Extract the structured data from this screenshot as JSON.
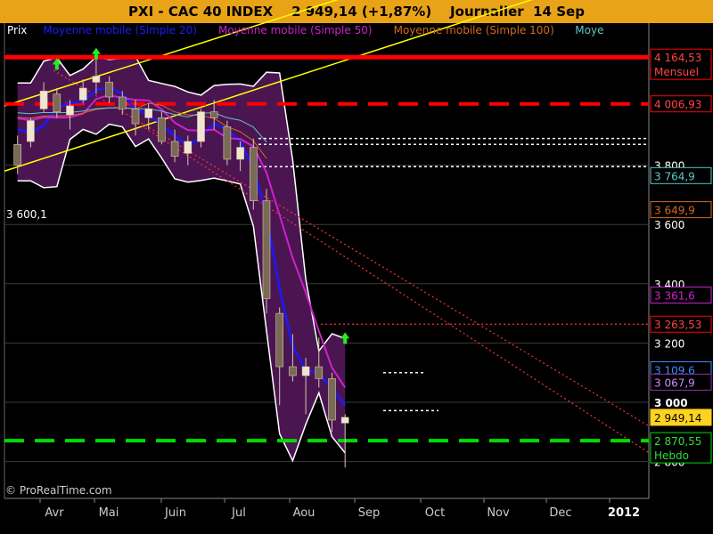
{
  "title": "PXI - CAC 40 INDEX    2 949,14 (+1,87%)    Journalier  14 Sep",
  "colors": {
    "title_bg": "#e8a317",
    "background": "#000000",
    "bands_fill": "#4b1552",
    "ma20": "#1a1aff",
    "ma50": "#cc22cc",
    "ma100": "#d2691e",
    "ma200": "#5fc7c7",
    "red_line": "#ff0000",
    "green_line": "#00dd00",
    "yellow_channel": "#ffff00",
    "candle": "#d8c8b0"
  },
  "chart_data": {
    "type": "candlestick",
    "instrument": "CAC 40 INDEX",
    "period": "Journalier",
    "last_date": "14 Sep",
    "last_value": "2 949,14",
    "change": "+1,87%",
    "y_ticks": [
      "3 800",
      "3 600",
      "3 400",
      "3 200",
      "3 000",
      "2 800"
    ],
    "x_months": [
      "Avr",
      "Mai",
      "Juin",
      "Jul",
      "Aou",
      "Sep",
      "Oct",
      "Nov",
      "Dec",
      "2012"
    ],
    "legend": [
      {
        "name": "Prix",
        "color": "#ffffff"
      },
      {
        "name": "Moyenne mobile (Simple 20)",
        "color": "#1a1aff"
      },
      {
        "name": "Moyenne mobile (Simple 50)",
        "color": "#cc22cc"
      },
      {
        "name": "Moyenne mobile (Simple 100)",
        "color": "#d2691e"
      },
      {
        "name": "Moye",
        "color": "#5fc7c7"
      }
    ],
    "value_tags": [
      {
        "value": 4164.53,
        "label": "4 164,53",
        "sub": "Mensuel",
        "bg": "#000000",
        "fg": "#ff4444",
        "border": "#ff0000"
      },
      {
        "value": 4006.93,
        "label": "4 006,93",
        "bg": "#000000",
        "fg": "#ff4444",
        "border": "#ff0000"
      },
      {
        "value": 3764.9,
        "label": "3 764,9",
        "bg": "#000000",
        "fg": "#5fc7c7",
        "border": "#5fc7c7"
      },
      {
        "value": 3649.9,
        "label": "3 649,9",
        "bg": "#000000",
        "fg": "#d2691e",
        "border": "#d2691e"
      },
      {
        "value": 3361.6,
        "label": "3 361,6",
        "bg": "#000000",
        "fg": "#cc22cc",
        "border": "#cc22cc"
      },
      {
        "value": 3263.53,
        "label": "3 263,53",
        "bg": "#000000",
        "fg": "#ff4444",
        "border": "#ff0000"
      },
      {
        "value": 3109.6,
        "label": "3 109,6",
        "bg": "#000000",
        "fg": "#3a8cff",
        "border": "#3a8cff"
      },
      {
        "value": 3067.9,
        "label": "3 067,9",
        "bg": "#000000",
        "fg": "#cc88ff",
        "border": "#8833aa"
      },
      {
        "value": 2949.14,
        "label": "2 949,14",
        "bg": "#ffd21f",
        "fg": "#000000",
        "border": "#ffd21f"
      },
      {
        "value": 2870.55,
        "label": "2 870,55",
        "sub": "Hebdo",
        "bg": "#000000",
        "fg": "#33dd33",
        "border": "#00dd00"
      }
    ],
    "horizontal_levels": [
      {
        "value": 4164.53,
        "style": "solid",
        "color": "#ff0000"
      },
      {
        "value": 4006.93,
        "style": "dashed",
        "color": "#ff0000"
      },
      {
        "value": 3263.53,
        "style": "dotted",
        "color": "#ff3333"
      },
      {
        "value": 2870.55,
        "style": "dashed",
        "color": "#00dd00"
      }
    ],
    "left_label": "3 600,1",
    "candles": [
      {
        "d": "03-21",
        "o": 3870,
        "h": 3900,
        "l": 3770,
        "c": 3800
      },
      {
        "d": "03-28",
        "o": 3880,
        "h": 3960,
        "l": 3860,
        "c": 3950
      },
      {
        "d": "04-04",
        "o": 3990,
        "h": 4080,
        "l": 3980,
        "c": 4050
      },
      {
        "d": "04-11",
        "o": 4040,
        "h": 4060,
        "l": 3960,
        "c": 3980
      },
      {
        "d": "04-18",
        "o": 3970,
        "h": 4020,
        "l": 3920,
        "c": 4000
      },
      {
        "d": "04-25",
        "o": 4020,
        "h": 4090,
        "l": 4010,
        "c": 4060
      },
      {
        "d": "05-02",
        "o": 4080,
        "h": 4170,
        "l": 4040,
        "c": 4100
      },
      {
        "d": "05-09",
        "o": 4080,
        "h": 4100,
        "l": 4010,
        "c": 4030
      },
      {
        "d": "05-16",
        "o": 4030,
        "h": 4050,
        "l": 3970,
        "c": 3990
      },
      {
        "d": "05-23",
        "o": 3990,
        "h": 4020,
        "l": 3900,
        "c": 3940
      },
      {
        "d": "05-30",
        "o": 3960,
        "h": 4010,
        "l": 3920,
        "c": 3990
      },
      {
        "d": "06-06",
        "o": 3960,
        "h": 3980,
        "l": 3870,
        "c": 3880
      },
      {
        "d": "06-13",
        "o": 3880,
        "h": 3920,
        "l": 3810,
        "c": 3830
      },
      {
        "d": "06-20",
        "o": 3840,
        "h": 3900,
        "l": 3800,
        "c": 3880
      },
      {
        "d": "06-27",
        "o": 3880,
        "h": 3990,
        "l": 3860,
        "c": 3980
      },
      {
        "d": "07-04",
        "o": 3980,
        "h": 4020,
        "l": 3920,
        "c": 3960
      },
      {
        "d": "07-11",
        "o": 3930,
        "h": 3950,
        "l": 3800,
        "c": 3820
      },
      {
        "d": "07-18",
        "o": 3820,
        "h": 3880,
        "l": 3780,
        "c": 3860
      },
      {
        "d": "07-25",
        "o": 3860,
        "h": 3890,
        "l": 3650,
        "c": 3680
      },
      {
        "d": "08-01",
        "o": 3680,
        "h": 3720,
        "l": 3300,
        "c": 3350
      },
      {
        "d": "08-08",
        "o": 3300,
        "h": 3320,
        "l": 2990,
        "c": 3120
      },
      {
        "d": "08-15",
        "o": 3120,
        "h": 3230,
        "l": 3070,
        "c": 3090
      },
      {
        "d": "08-22",
        "o": 3090,
        "h": 3150,
        "l": 2960,
        "c": 3120
      },
      {
        "d": "08-29",
        "o": 3120,
        "h": 3220,
        "l": 3050,
        "c": 3080
      },
      {
        "d": "09-05",
        "o": 3080,
        "h": 3100,
        "l": 2900,
        "c": 2940
      },
      {
        "d": "09-12",
        "o": 2930,
        "h": 2960,
        "l": 2780,
        "c": 2949.14
      }
    ]
  },
  "footer": "© ProRealTime.com"
}
